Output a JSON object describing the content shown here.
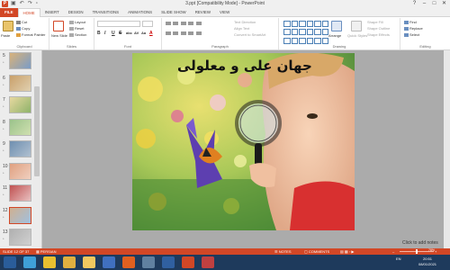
{
  "window": {
    "title": "3.ppt [Compatibility Mode] - PowerPoint",
    "app_icon": "powerpoint-icon",
    "quick_access": [
      "save-icon",
      "undo-icon",
      "redo-icon",
      "slideshow-icon"
    ],
    "controls": [
      "help-icon",
      "minimize-icon",
      "restore-icon",
      "close-icon"
    ]
  },
  "tabs": [
    "FILE",
    "HOME",
    "INSERT",
    "DESIGN",
    "TRANSITIONS",
    "ANIMATIONS",
    "SLIDE SHOW",
    "REVIEW",
    "VIEW"
  ],
  "active_tab": "HOME",
  "ribbon": {
    "clipboard": {
      "paste": "Paste",
      "cut": "Cut",
      "copy": "Copy",
      "format_painter": "Format Painter",
      "label": "Clipboard"
    },
    "slides": {
      "new_slide": "New Slide",
      "layout": "Layout",
      "reset": "Reset",
      "section": "Section",
      "label": "Slides"
    },
    "font": {
      "label": "Font",
      "bold": "B",
      "italic": "I",
      "underline": "U",
      "strike": "S",
      "shadow": "abc",
      "spacing": "AV",
      "case": "Aa",
      "color": "A"
    },
    "paragraph": {
      "text_direction": "Text Direction",
      "align_text": "Align Text",
      "smartart": "Convert to SmartArt",
      "label": "Paragraph"
    },
    "drawing": {
      "arrange": "Arrange",
      "quick_styles": "Quick Styles",
      "shape_fill": "Shape Fill",
      "shape_outline": "Shape Outline",
      "shape_effects": "Shape Effects",
      "label": "Drawing"
    },
    "editing": {
      "find": "Find",
      "replace": "Replace",
      "select": "Select",
      "label": "Editing"
    }
  },
  "slides_panel": {
    "items": [
      {
        "num": "5",
        "colors": [
          "#d9b27a",
          "#7a9cc7"
        ]
      },
      {
        "num": "6",
        "colors": [
          "#c9a06a",
          "#e0d0b0"
        ]
      },
      {
        "num": "7",
        "colors": [
          "#e8d8a0",
          "#8fb36a"
        ]
      },
      {
        "num": "8",
        "colors": [
          "#9ac28a",
          "#d0e0b0"
        ]
      },
      {
        "num": "9",
        "colors": [
          "#6f8fb0",
          "#b0c0d0"
        ]
      },
      {
        "num": "10",
        "colors": [
          "#e0a080",
          "#f0d0c0"
        ]
      },
      {
        "num": "11",
        "colors": [
          "#c05050",
          "#e8c0c0"
        ]
      },
      {
        "num": "12",
        "colors": [
          "#d0b090",
          "#a0c0e0"
        ]
      },
      {
        "num": "13",
        "colors": [
          "#b0b0b0",
          "#d0d0d0"
        ]
      }
    ],
    "selected_index": 7
  },
  "slide": {
    "title": "جهان علی و معلولی"
  },
  "notes_hint": "Click to add notes",
  "status": {
    "slide_count": "SLIDE 12 OF 37",
    "language": "PERSIAN",
    "notes": "NOTES",
    "comments": "COMMENTS",
    "zoom": "78%",
    "zoom_level": 0.5
  },
  "taskbar": {
    "buttons": [
      {
        "name": "start-button-icon",
        "color": "#2a5d9a"
      },
      {
        "name": "telegram-icon",
        "color": "#3fa0d8"
      },
      {
        "name": "chrome-icon",
        "color": "#e8c030"
      },
      {
        "name": "explorer-icon",
        "color": "#e0b040"
      },
      {
        "name": "folder-icon",
        "color": "#f0c860"
      },
      {
        "name": "media-icon",
        "color": "#4070c0"
      },
      {
        "name": "firefox-icon",
        "color": "#e06020"
      },
      {
        "name": "app-icon",
        "color": "#6080a0"
      },
      {
        "name": "photoshop-icon",
        "color": "#3060a0"
      },
      {
        "name": "powerpoint-taskbar-icon",
        "color": "#d24726"
      },
      {
        "name": "paint-icon",
        "color": "#c04040"
      }
    ],
    "tray": {
      "time": "20:51",
      "date": "08/01/2021",
      "lang": "EN"
    }
  },
  "colors": {
    "accent": "#d24726",
    "taskbar": "#1e3a5c"
  }
}
